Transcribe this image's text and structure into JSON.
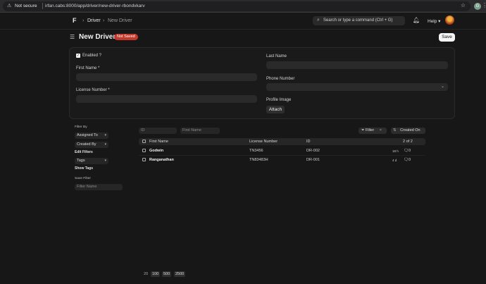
{
  "browser": {
    "security": "Not secure",
    "url": "irfan.cabs:8000/app/driver/new-driver-rbondvkarv",
    "extension_initial": "G"
  },
  "header": {
    "logo": "F",
    "crumbs": [
      "Driver",
      "New Driver"
    ],
    "search_placeholder": "Search or type a command (Ctrl + G)",
    "help": "Help"
  },
  "page": {
    "title": "New Driver",
    "status": "Not Saved",
    "save": "Save"
  },
  "form": {
    "enabled_label": "Enabled ?",
    "first_name_label": "First Name *",
    "license_label": "License Number *",
    "last_name_label": "Last Name",
    "phone_label": "Phone Number",
    "profile_image_label": "Profile Image",
    "attach": "Attach"
  },
  "sidebar": {
    "filter_by": "Filter By",
    "assigned_to": "Assigned To",
    "created_by": "Created By",
    "edit_filters": "Edit Filters",
    "tags": "Tags",
    "show_tags": "Show Tags",
    "save_filter": "Save Filter",
    "filter_name_placeholder": "Filter Name"
  },
  "list": {
    "id_placeholder": "ID",
    "first_name_placeholder": "First Name",
    "filter": "Filter",
    "sort": "Created On",
    "columns": [
      "First Name",
      "License Number",
      "ID"
    ],
    "count": "2 of 2",
    "rows": [
      {
        "first_name": "Godwin",
        "license": "TN3456",
        "id": "DR-002",
        "time": "18 h",
        "comments": "0"
      },
      {
        "first_name": "Ranganathan",
        "license": "TN83483H",
        "id": "DR-001",
        "time": "4 d",
        "comments": "0"
      }
    ],
    "page_sizes": [
      "20",
      "100",
      "500",
      "2500"
    ]
  }
}
